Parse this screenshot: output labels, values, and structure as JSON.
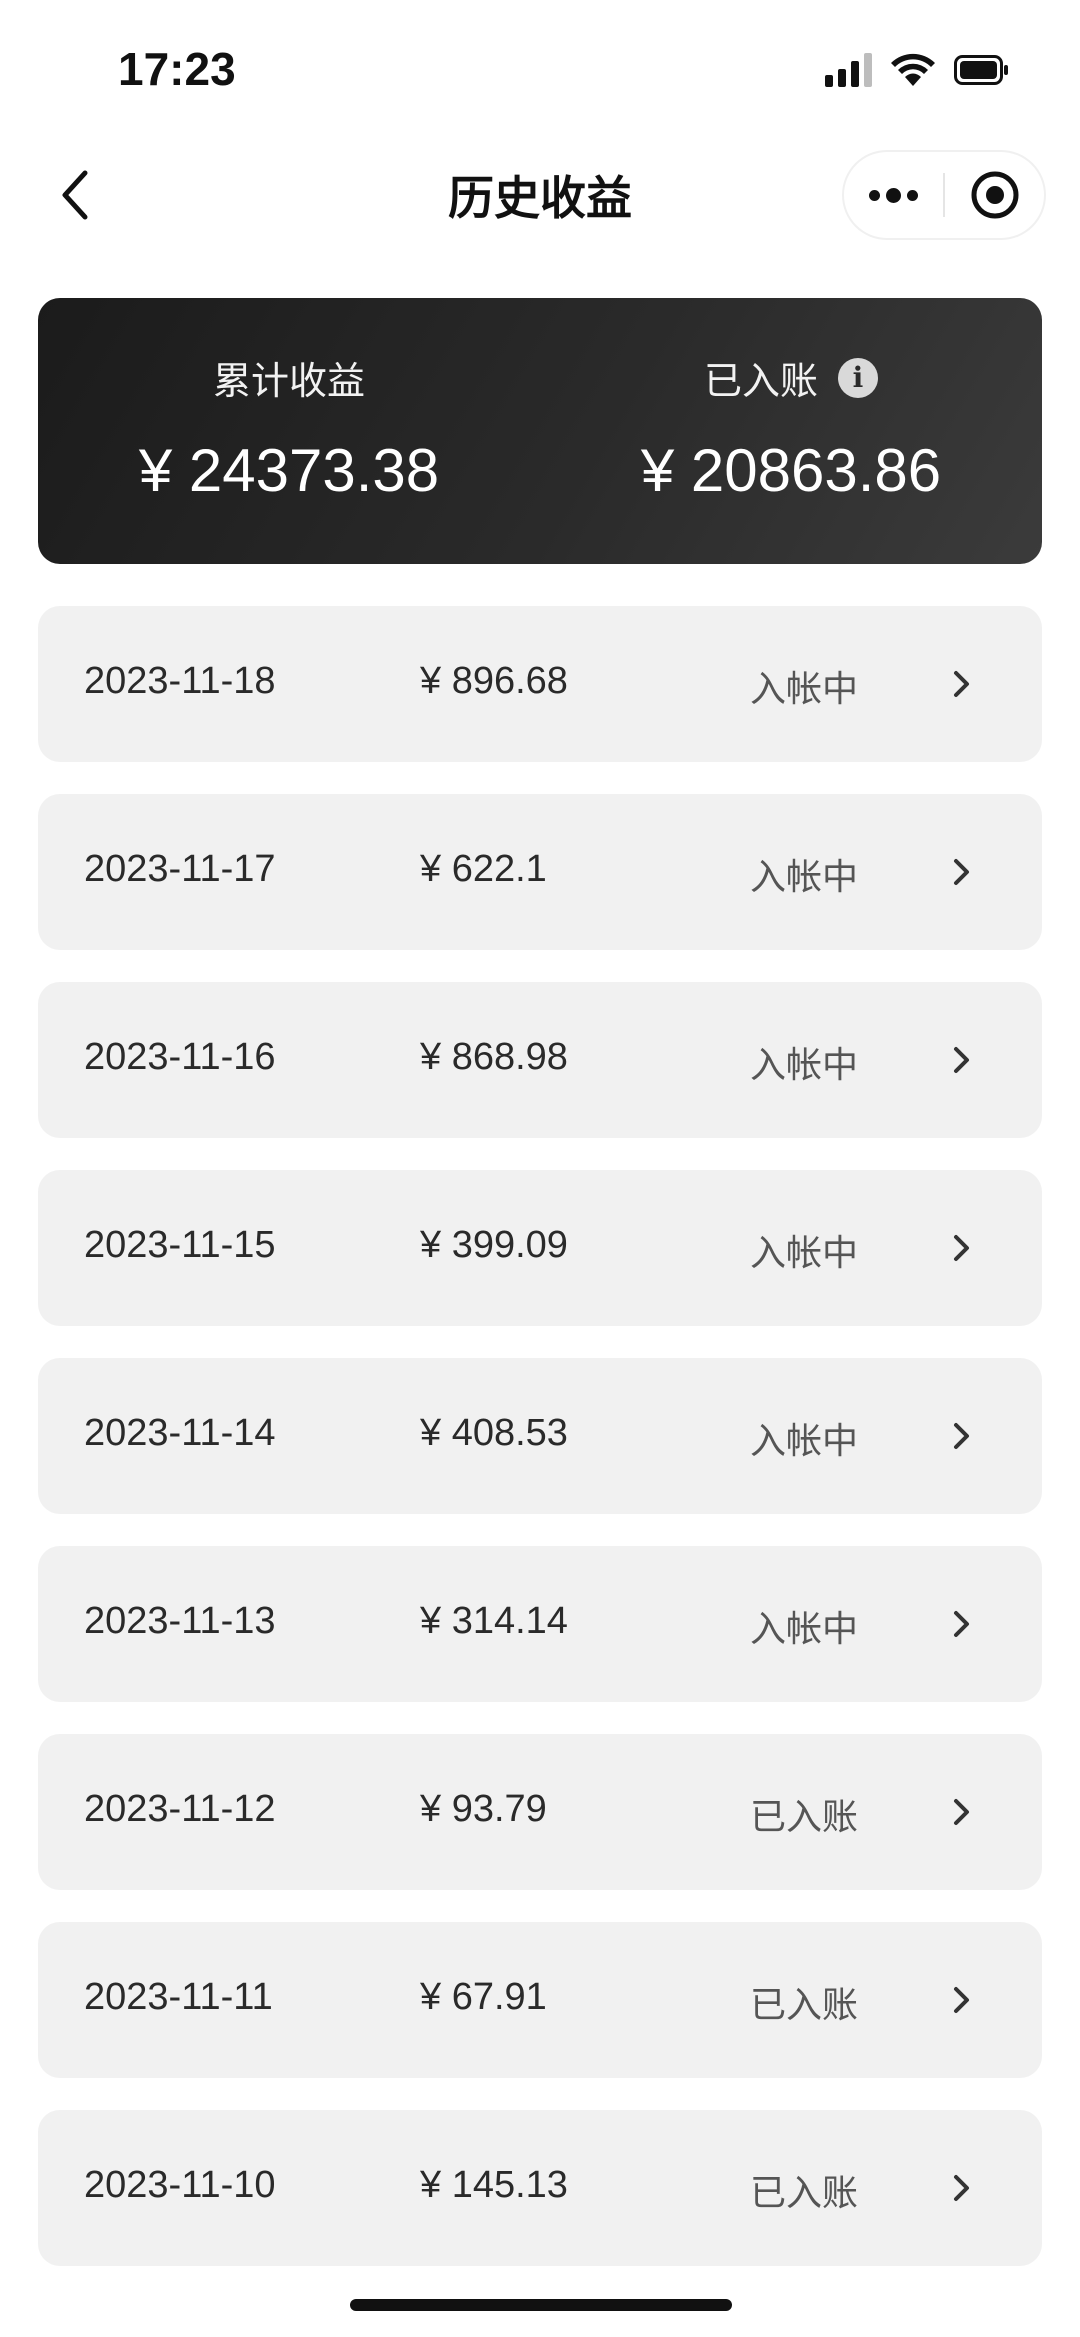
{
  "status_bar": {
    "time": "17:23",
    "icons": [
      "signal-icon",
      "wifi-icon",
      "battery-icon"
    ]
  },
  "nav": {
    "title": "历史收益",
    "back_icon": "chevron-left-icon",
    "more_icon": "more-dots-icon",
    "close_icon": "target-circle-icon"
  },
  "summary": {
    "total_label": "累计收益",
    "total_value": "¥ 24373.38",
    "credited_label": "已入账",
    "credited_info_icon": "i",
    "credited_value": "¥ 20863.86"
  },
  "rows": [
    {
      "date": "2023-11-18",
      "amount": "¥ 896.68",
      "status": "入帐中"
    },
    {
      "date": "2023-11-17",
      "amount": "¥ 622.1",
      "status": "入帐中"
    },
    {
      "date": "2023-11-16",
      "amount": "¥ 868.98",
      "status": "入帐中"
    },
    {
      "date": "2023-11-15",
      "amount": "¥ 399.09",
      "status": "入帐中"
    },
    {
      "date": "2023-11-14",
      "amount": "¥ 408.53",
      "status": "入帐中"
    },
    {
      "date": "2023-11-13",
      "amount": "¥ 314.14",
      "status": "入帐中"
    },
    {
      "date": "2023-11-12",
      "amount": "¥ 93.79",
      "status": "已入账"
    },
    {
      "date": "2023-11-11",
      "amount": "¥ 67.91",
      "status": "已入账"
    },
    {
      "date": "2023-11-10",
      "amount": "¥ 145.13",
      "status": "已入账"
    }
  ],
  "colors": {
    "card_dark": "#1b1b1b",
    "row_bg": "#f1f1f1",
    "status_text": "#555555"
  }
}
